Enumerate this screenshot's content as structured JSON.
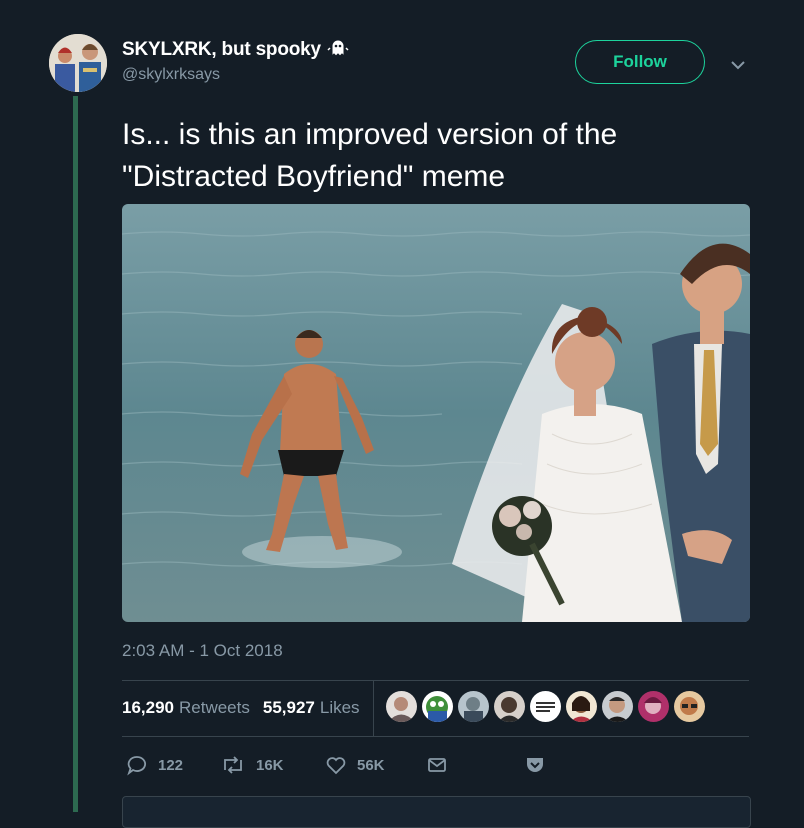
{
  "header": {
    "display_name": "SKYLXRK, but spooky",
    "handle": "@skylxrksays",
    "follow_label": "Follow",
    "name_emoji": "ghost-icon"
  },
  "tweet": {
    "text": "Is... is this an improved version of the \"Distracted Boyfriend\" meme",
    "timestamp": "2:03 AM - 1 Oct 2018",
    "image": "photo of a bride and groom on a beach with a man in swim trunks walking out of the water"
  },
  "stats": {
    "retweets_count": "16,290",
    "retweets_label": "Retweets",
    "likes_count": "55,927",
    "likes_label": "Likes"
  },
  "actions": {
    "reply_count": "122",
    "retweet_count": "16K",
    "like_count": "56K"
  },
  "colors": {
    "background": "#141d26",
    "accent": "#1dd39c",
    "muted_text": "#8899a6",
    "thread_line": "#2d6a50"
  }
}
